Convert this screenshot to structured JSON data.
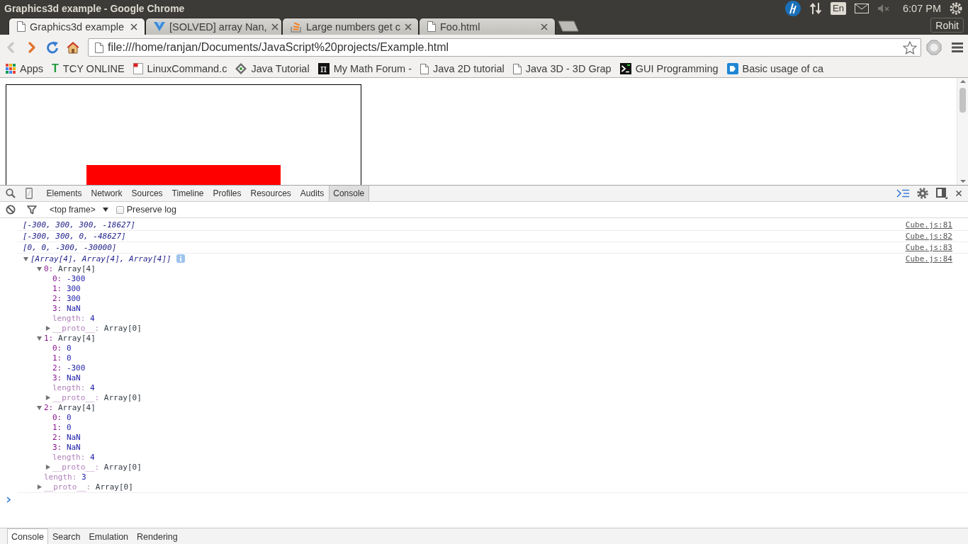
{
  "window": {
    "title": "Graphics3d example - Google Chrome"
  },
  "system_tray": {
    "keyboard_layout": "En",
    "clock": "6:07 PM"
  },
  "tabs": [
    {
      "title": "Graphics3d example",
      "selected": true
    },
    {
      "title": "[SOLVED] array Nan,",
      "selected": false
    },
    {
      "title": "Large numbers get c",
      "selected": false
    },
    {
      "title": "Foo.html",
      "selected": false
    }
  ],
  "profile": {
    "name": "Rohit"
  },
  "toolbar": {
    "back": {
      "disabled": true
    },
    "forward": {
      "disabled": false
    },
    "url": "file:///home/ranjan/Documents/JavaScript%20projects/Example.html"
  },
  "bookmarks": [
    {
      "label": "Apps"
    },
    {
      "glyph": "T",
      "label": "TCY ONLINE"
    },
    {
      "label": "LinuxCommand.c"
    },
    {
      "label": "Java Tutorial"
    },
    {
      "glyph": "π",
      "label": "My Math Forum -"
    },
    {
      "label": "Java 2D tutorial"
    },
    {
      "label": "Java 3D - 3D Grap"
    },
    {
      "label": "GUI Programming"
    },
    {
      "label": "Basic usage of ca"
    }
  ],
  "devtools": {
    "panels": [
      {
        "label": "Elements",
        "selected": false
      },
      {
        "label": "Network",
        "selected": false
      },
      {
        "label": "Sources",
        "selected": false
      },
      {
        "label": "Timeline",
        "selected": false
      },
      {
        "label": "Profiles",
        "selected": false
      },
      {
        "label": "Resources",
        "selected": false
      },
      {
        "label": "Audits",
        "selected": false
      },
      {
        "label": "Console",
        "selected": true
      }
    ],
    "console_toolbar": {
      "context": "<top frame>",
      "preserve_log": {
        "label": "Preserve log",
        "checked": false
      }
    },
    "messages": [
      {
        "text": "[-300, 300, 300, -18627]",
        "source": "Cube.js:81"
      },
      {
        "text": "[-300, 300, 0, -48627]",
        "source": "Cube.js:82"
      },
      {
        "text": "[0, 0, -300, -30000]",
        "source": "Cube.js:83"
      },
      {
        "text": "[Array[4], Array[4], Array[4]]",
        "source": "Cube.js:84",
        "expanded": true,
        "children": [
          {
            "key": "0:",
            "value": "Array[4]",
            "enumerable": true,
            "expanded": true,
            "children": [
              {
                "key": "0:",
                "value": "-300",
                "enumerable": true
              },
              {
                "key": "1:",
                "value": "300",
                "enumerable": true
              },
              {
                "key": "2:",
                "value": "300",
                "enumerable": true
              },
              {
                "key": "3:",
                "value": "NaN",
                "enumerable": true
              },
              {
                "key": "length:",
                "value": "4",
                "enumerable": false
              },
              {
                "key": "__proto__:",
                "value": "Array[0]",
                "enumerable": false,
                "expanded": false
              }
            ]
          },
          {
            "key": "1:",
            "value": "Array[4]",
            "enumerable": true,
            "expanded": true,
            "children": [
              {
                "key": "0:",
                "value": "0",
                "enumerable": true
              },
              {
                "key": "1:",
                "value": "0",
                "enumerable": true
              },
              {
                "key": "2:",
                "value": "-300",
                "enumerable": true
              },
              {
                "key": "3:",
                "value": "NaN",
                "enumerable": true
              },
              {
                "key": "length:",
                "value": "4",
                "enumerable": false
              },
              {
                "key": "__proto__:",
                "value": "Array[0]",
                "enumerable": false,
                "expanded": false
              }
            ]
          },
          {
            "key": "2:",
            "value": "Array[4]",
            "enumerable": true,
            "expanded": true,
            "children": [
              {
                "key": "0:",
                "value": "0",
                "enumerable": true
              },
              {
                "key": "1:",
                "value": "0",
                "enumerable": true
              },
              {
                "key": "2:",
                "value": "NaN",
                "enumerable": true
              },
              {
                "key": "3:",
                "value": "NaN",
                "enumerable": true
              },
              {
                "key": "length:",
                "value": "4",
                "enumerable": false
              },
              {
                "key": "__proto__:",
                "value": "Array[0]",
                "enumerable": false,
                "expanded": false
              }
            ]
          },
          {
            "key": "length:",
            "value": "3",
            "enumerable": false
          },
          {
            "key": "__proto__:",
            "value": "Array[0]",
            "enumerable": false,
            "expanded": false
          }
        ]
      }
    ],
    "drawer_tabs": [
      {
        "label": "Console",
        "selected": true
      },
      {
        "label": "Search",
        "selected": false
      },
      {
        "label": "Emulation",
        "selected": false
      },
      {
        "label": "Rendering",
        "selected": false
      }
    ]
  }
}
